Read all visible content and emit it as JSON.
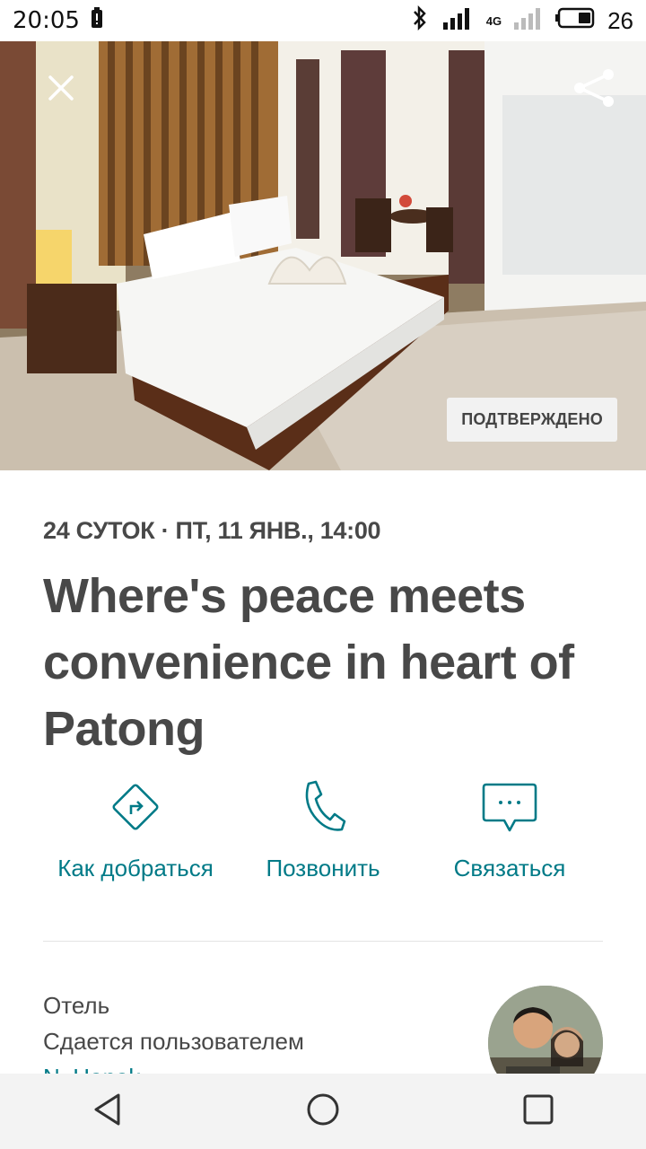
{
  "status_bar": {
    "time": "20:05",
    "network_label": "4G",
    "battery_level": "26"
  },
  "hero": {
    "badge": "ПОДТВЕРЖДЕНО",
    "close_icon": "close-icon",
    "share_icon": "share-icon"
  },
  "trip": {
    "meta": "24 СУТОК · ПТ, 11 ЯНВ., 14:00",
    "title": "Where's peace meets convenience in heart of Patong"
  },
  "actions": [
    {
      "label": "Как добраться",
      "icon": "directions-icon"
    },
    {
      "label": "Позвонить",
      "icon": "phone-icon"
    },
    {
      "label": "Связаться",
      "icon": "message-icon"
    }
  ],
  "listing": {
    "type": "Отель",
    "hosted_by": "Сдается пользователем",
    "host_name": "N. Hanak"
  },
  "nav": [
    "back-icon",
    "home-icon",
    "recents-icon"
  ],
  "colors": {
    "accent": "#007a87",
    "text": "#484848"
  }
}
